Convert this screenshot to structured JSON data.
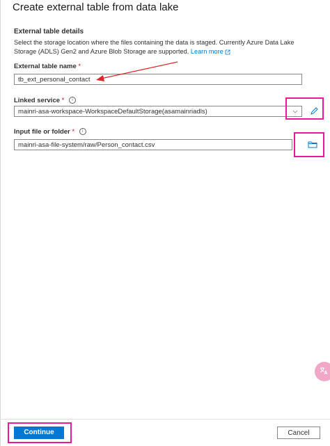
{
  "title": "Create external table from data lake",
  "section": {
    "title": "External table details",
    "description": "Select the storage location where the files containing the data is staged. Currently Azure Data Lake Storage (ADLS) Gen2 and Azure Blob Storage are supported.",
    "learn_more": "Learn more"
  },
  "fields": {
    "table_name": {
      "label": "External table name",
      "required": "*",
      "value": "tb_ext_personal_contact"
    },
    "linked_service": {
      "label": "Linked service",
      "required": "*",
      "info": "i",
      "value": "mainri-asa-workspace-WorkspaceDefaultStorage(asamainriadls)"
    },
    "input_path": {
      "label": "Input file or folder",
      "required": "*",
      "info": "i",
      "value": "mainri-asa-file-system/raw/Person_contact.csv"
    }
  },
  "footer": {
    "continue_label": "Continue",
    "cancel_label": "Cancel"
  },
  "icons": {
    "edit": "pencil-icon",
    "browse": "folder-icon",
    "dropdown": "chevron-down-icon",
    "external": "external-link-icon",
    "translate": "translate-icon"
  },
  "colors": {
    "primary": "#0078d4",
    "highlight": "#e8199a",
    "annotation_arrow": "#e0262b",
    "required": "#a4262c"
  }
}
